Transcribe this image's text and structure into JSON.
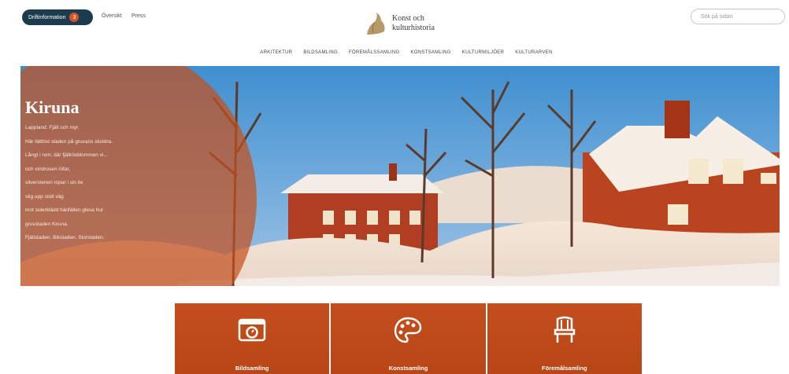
{
  "header": {
    "open_button": {
      "label": "Driftinformation",
      "count": "3"
    },
    "links": [
      "Översikt",
      "Press"
    ],
    "logo_line1": "Konst och",
    "logo_line2": "kulturhistoria",
    "search_placeholder": "Sök på sidan",
    "nav": [
      "ARKITEKTUR",
      "BILDSAMLING",
      "FÖREMÅLSSAMLING",
      "KONSTSAMLING",
      "KULTURMILJÖER",
      "KULTURARVEN"
    ]
  },
  "hero": {
    "title": "Kiruna",
    "lines": [
      "Lappland. Fjäll och myr.",
      "Här lättlöst staden på gruvans skuldra.",
      "Långt i norr, där fjällrösblommen vi...",
      "och vindrosen röfar,",
      "silverstenen ropar i sin lie",
      "stig upp stolt väg",
      "mot siderklädd hänfällen glesa hur",
      "gruvstaden Kiruna.",
      "Fjällstaden. Bikstaden. Storstaden."
    ]
  },
  "cards": [
    {
      "label": "Bildsamling",
      "icon": "photo-frame-icon"
    },
    {
      "label": "Konstsamling",
      "icon": "palette-icon"
    },
    {
      "label": "Föremålsamling",
      "icon": "chair-icon"
    }
  ],
  "colors": {
    "accent": "#c44e1d",
    "navy": "#1d3b4f"
  }
}
